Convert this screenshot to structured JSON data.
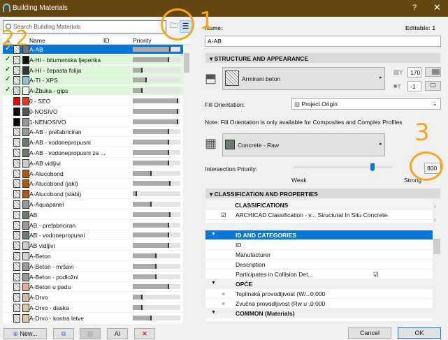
{
  "window": {
    "title": "Building Materials",
    "help": "?",
    "close": "✕"
  },
  "search": {
    "placeholder": "Search Building Materials"
  },
  "columns": {
    "name": "Name",
    "id": "ID",
    "priority": "Priority"
  },
  "materials": [
    {
      "name": "A-AB",
      "checked": true,
      "state": "selected",
      "fill": "#777",
      "priority": 0.8
    },
    {
      "name": "A-HI - bitumenska ljepenka",
      "checked": true,
      "state": "green",
      "fill": "#111",
      "priority": 0.76
    },
    {
      "name": "A-HI - čepasta folija",
      "checked": true,
      "state": "green",
      "fill": "#333",
      "priority": 0.2
    },
    {
      "name": "A-TI - XPS",
      "checked": true,
      "state": "green",
      "fill": "#8fc1e3",
      "priority": 0.29
    },
    {
      "name": "A-Žbuka - gips",
      "checked": true,
      "state": "green",
      "fill": "#fff",
      "priority": 0.2
    },
    {
      "name": "0 - SEO",
      "fill": "#e63a1e",
      "pat": "#e00",
      "priority": 0.95
    },
    {
      "name": "0-NOSIVO",
      "fill": "#555",
      "pat": "#000",
      "priority": 0.95
    },
    {
      "name": "1-NENOSIVO",
      "fill": "#999",
      "pat": "#000",
      "priority": 0.95
    },
    {
      "name": "A-AB - prefabriciran",
      "fill": "#999",
      "priority": 0.76
    },
    {
      "name": "A-AB - vodonepropusni",
      "fill": "#6d7d6d",
      "priority": 0.76
    },
    {
      "name": "A-AB - vodonepropusni za ...",
      "fill": "#6d7d6d",
      "priority": 0.76
    },
    {
      "name": "A-AB vidljivi",
      "fill": "#ccc",
      "priority": 0.76
    },
    {
      "name": "A-Alucobond",
      "fill": "#b5560a",
      "priority": 0.4
    },
    {
      "name": "A-Alucobond (jaki)",
      "fill": "#b5560a",
      "priority": 0.8
    },
    {
      "name": "A-Alucobond (slabi)",
      "fill": "#b5560a",
      "priority": 0.09
    },
    {
      "name": "A-Aquapanel",
      "fill": "#999",
      "priority": 0.4
    },
    {
      "name": "AB",
      "fill": "#6d7d6d",
      "priority": 0.8
    },
    {
      "name": "AB - prefabriciran",
      "fill": "#999",
      "priority": 0.76
    },
    {
      "name": "AB - vodonepropusni",
      "fill": "#6d7d6d",
      "priority": 0.76
    },
    {
      "name": "AB vidljivi",
      "fill": "#ccc",
      "priority": 0.76
    },
    {
      "name": "A-Beton",
      "fill": "#cfd6d6",
      "priority": 0.5
    },
    {
      "name": "A-Beton - mršavi",
      "fill": "#999",
      "priority": 0.5
    },
    {
      "name": "A-Beton - podložni",
      "fill": "#999",
      "priority": 0.5
    },
    {
      "name": "A-Beton u padu",
      "fill": "#e8aa9a",
      "priority": 0.76
    },
    {
      "name": "A-Drvo",
      "fill": "#d1bfa4",
      "priority": 0.2
    },
    {
      "name": "A-Drvo - daska",
      "fill": "#dcc6a0",
      "priority": 0.2
    },
    {
      "name": "A-Drvo - kontra letve",
      "fill": "#dcc6a0",
      "priority": 0.4
    }
  ],
  "bottom_buttons": {
    "new": "New..."
  },
  "detail": {
    "name_label": "Name:",
    "editable": "Editable: 1",
    "name_value": "A-AB",
    "structure_header": "STRUCTURE AND APPEARANCE",
    "cut_fill": "Armirani beton",
    "pen1": "170",
    "pen2": "-1",
    "fill_orientation_label": "Fill Orientation:",
    "fill_orientation_value": "Project Origin",
    "note": "Note: Fill Orientation is only available for Composites and Complex Profiles",
    "surface": "Concrete - Raw",
    "surface_color": "#6f7a6e",
    "intersection_label": "Intersection Priority:",
    "intersection_value": "800",
    "intersection_fraction": 0.8,
    "weak": "Weak",
    "strong": "Strong",
    "classification_header": "CLASSIFICATION AND PROPERTIES",
    "classifications_title": "CLASSIFICATIONS",
    "classification_row": "ARCHICAD Classification - v... Structural In Situ Concrete",
    "props": [
      {
        "label": "ID AND CATEGORIES",
        "type": "hi"
      },
      {
        "label": "ID"
      },
      {
        "label": "Manufacturer"
      },
      {
        "label": "Description"
      },
      {
        "label": "Participates in Collision Det...",
        "checkbox": true
      },
      {
        "label": "OPĆE",
        "type": "grp"
      },
      {
        "label": "Toplinska provodljivost (W/...",
        "value": "0,000",
        "link": true
      },
      {
        "label": "Zvučna provodljivost (Rw u ...",
        "value": "0,000",
        "link": true
      },
      {
        "label": "COMMON (Materials)",
        "type": "grp"
      }
    ],
    "cancel": "Cancel",
    "ok": "OK"
  },
  "annotations": [
    "1",
    "2",
    "3"
  ]
}
